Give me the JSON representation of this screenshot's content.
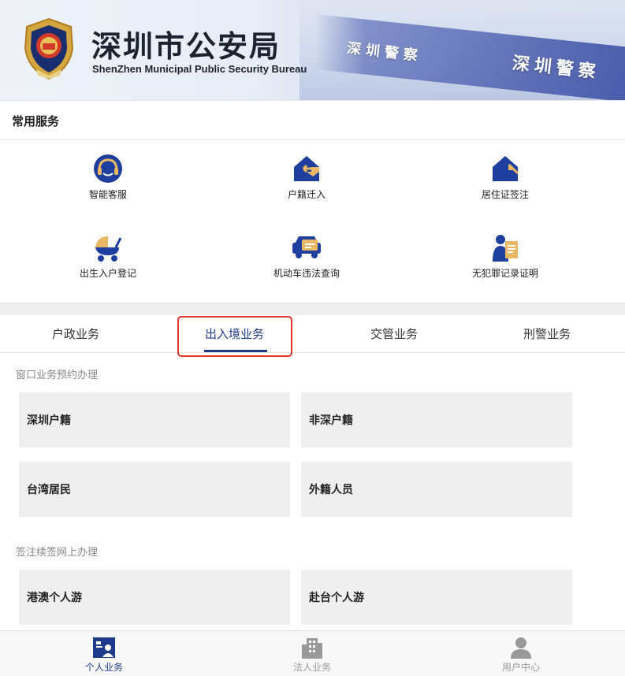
{
  "header": {
    "title": "深圳市公安局",
    "subtitle": "ShenZhen Municipal Public Security Bureau",
    "sign_text_1": "深圳警察",
    "sign_text_2": "深圳警察"
  },
  "common_services": {
    "title": "常用服务",
    "items": [
      {
        "label": "智能客服",
        "icon": "headset-icon"
      },
      {
        "label": "户籍迁入",
        "icon": "house-arrow-in-icon"
      },
      {
        "label": "居住证签注",
        "icon": "house-arrow-icon"
      },
      {
        "label": "出生入户登记",
        "icon": "stroller-icon"
      },
      {
        "label": "机动车违法查询",
        "icon": "car-icon"
      },
      {
        "label": "无犯罪记录证明",
        "icon": "certificate-icon"
      }
    ]
  },
  "tabs": [
    {
      "label": "户政业务",
      "active": false
    },
    {
      "label": "出入境业务",
      "active": true
    },
    {
      "label": "交管业务",
      "active": false
    },
    {
      "label": "刑警业务",
      "active": false
    }
  ],
  "window_booking": {
    "title": "窗口业务预约办理",
    "items": [
      "深圳户籍",
      "非深户籍",
      "台湾居民",
      "外籍人员"
    ]
  },
  "online_visa": {
    "title": "签注续签网上办理",
    "items": [
      "港澳个人游",
      "赴台个人游"
    ]
  },
  "bottom_nav": [
    {
      "label": "个人业务",
      "icon": "person-card-icon",
      "active": true
    },
    {
      "label": "法人业务",
      "icon": "building-icon",
      "active": false
    },
    {
      "label": "用户中心",
      "icon": "user-icon",
      "active": false
    }
  ],
  "colors": {
    "accent": "#1e3a8a",
    "icon_blue": "#1f3f9f",
    "icon_gold": "#e8b864",
    "highlight": "#e5322a"
  }
}
